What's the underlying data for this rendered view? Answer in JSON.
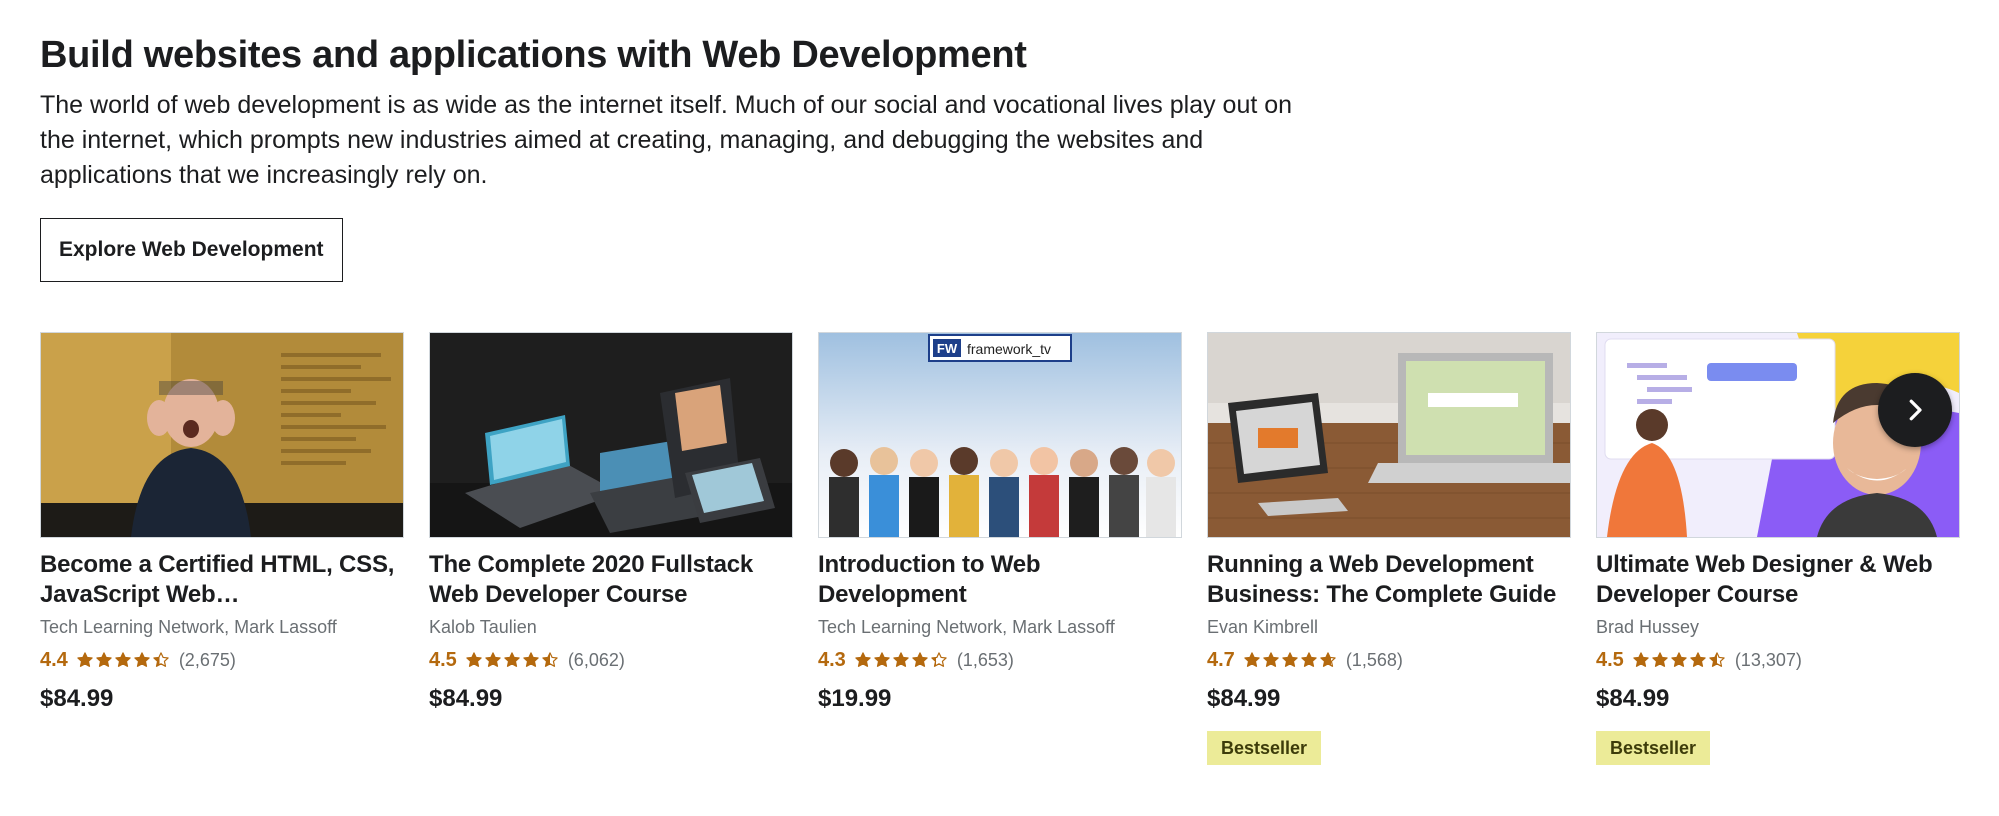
{
  "section": {
    "heading": "Build websites and applications with Web Development",
    "description": "The world of web development is as wide as the internet itself. Much of our social and vocational lives play out on the internet, which prompts new industries aimed at creating, managing, and debugging the websites and applications that we increasingly rely on.",
    "explore_button": "Explore Web Development"
  },
  "colors": {
    "rating": "#b4690e",
    "badge_bg": "#eceb98",
    "text": "#1c1d1f",
    "muted": "#6a6f73"
  },
  "courses": [
    {
      "title": "Become a Certified HTML, CSS, JavaScript Web…",
      "instructor": "Tech Learning Network, Mark Lassoff",
      "rating": "4.4",
      "rating_value": 4.4,
      "count": "(2,675)",
      "price": "$84.99",
      "badge": ""
    },
    {
      "title": "The Complete 2020 Fullstack Web Developer Course",
      "instructor": "Kalob Taulien",
      "rating": "4.5",
      "rating_value": 4.5,
      "count": "(6,062)",
      "price": "$84.99",
      "badge": ""
    },
    {
      "title": "Introduction to Web Development",
      "instructor": "Tech Learning Network, Mark Lassoff",
      "rating": "4.3",
      "rating_value": 4.3,
      "count": "(1,653)",
      "price": "$19.99",
      "badge": "",
      "thumb_logo_text": "framework_tv"
    },
    {
      "title": "Running a Web Development Business: The Complete Guide",
      "instructor": "Evan Kimbrell",
      "rating": "4.7",
      "rating_value": 4.7,
      "count": "(1,568)",
      "price": "$84.99",
      "badge": "Bestseller"
    },
    {
      "title": "Ultimate Web Designer & Web Developer Course",
      "instructor": "Brad Hussey",
      "rating": "4.5",
      "rating_value": 4.5,
      "count": "(13,307)",
      "price": "$84.99",
      "badge": "Bestseller"
    }
  ],
  "icons": {
    "star": "star-icon",
    "next": "chevron-right-icon"
  }
}
